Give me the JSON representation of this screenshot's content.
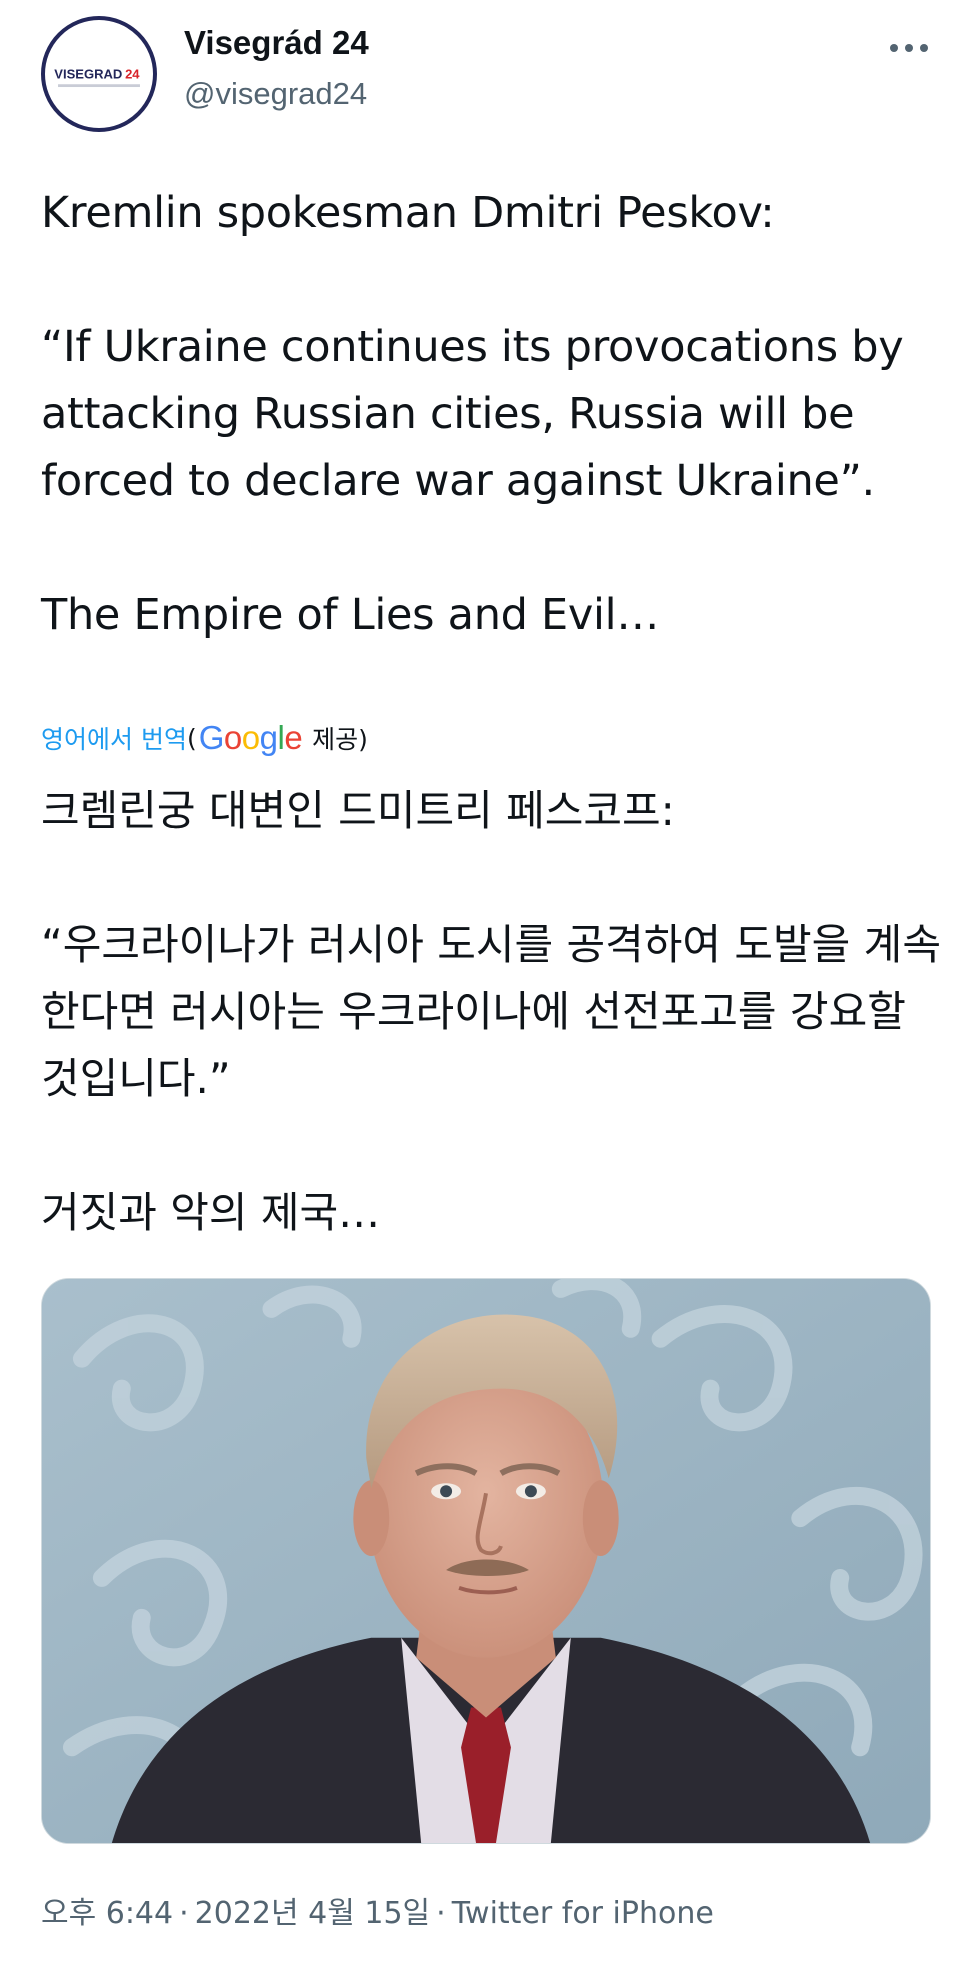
{
  "account": {
    "display_name": "Visegrád 24",
    "handle": "@visegrad24",
    "avatar_logo_text": "VISEGRAD24",
    "avatar_icon": "visegrad24-logo"
  },
  "more_icon": "more-horizontal-icon",
  "tweet": {
    "text": "Kremlin spokesman Dmitri Peskov:\n\n“If Ukraine continues its provocations by attacking Russian cities, Russia will be forced to declare war against Ukraine”.\n\nThe Empire of Lies and Evil…"
  },
  "translation": {
    "link_label": "영어에서 번역",
    "open_paren": "(",
    "provider": "Google",
    "provided_label": "제공)",
    "text": "크렘린궁 대변인 드미트리 페스코프:\n\n “우크라이나가 러시아 도시를 공격하여 도발을 계속한다면 러시아는 우크라이나에 선전포고를 강요할 것입니다.”\n\n 거짓과 악의 제국…"
  },
  "media": {
    "type": "photo",
    "subject": "portrait-photo"
  },
  "meta": {
    "time": "오후 6:44",
    "separator": "·",
    "date": "2022년 4월 15일",
    "source": "Twitter for iPhone"
  },
  "colors": {
    "link": "#1d9bf0",
    "secondary_text": "#536471",
    "primary_text": "#0f1419",
    "avatar_ring": "#23275a",
    "logo_red": "#d8232a"
  }
}
